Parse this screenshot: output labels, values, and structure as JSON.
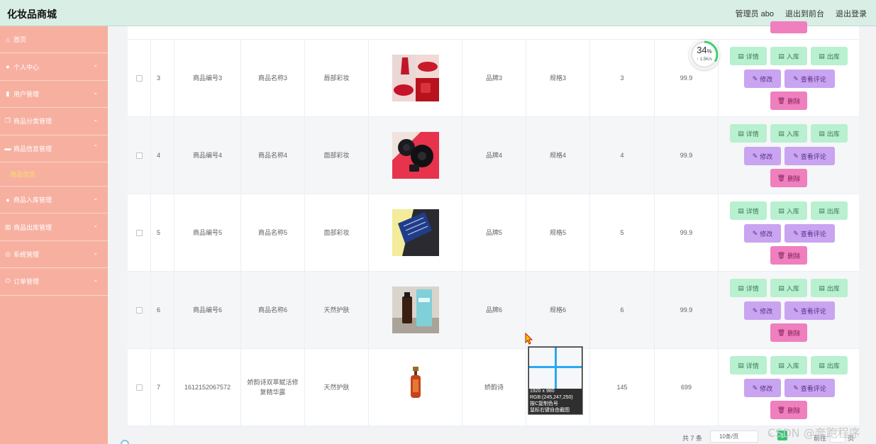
{
  "header": {
    "title": "化妆品商城",
    "admin": "管理员 abo",
    "to_front": "退出到前台",
    "logout": "退出登录"
  },
  "sidebar": {
    "items": [
      {
        "label": "首页",
        "icon": "home-icon",
        "glyph": "⌂",
        "chevron": false
      },
      {
        "label": "个人中心",
        "icon": "user-icon",
        "glyph": "●",
        "chevron": true
      },
      {
        "label": "用户管理",
        "icon": "users-icon",
        "glyph": "▮",
        "chevron": true
      },
      {
        "label": "商品分类管理",
        "icon": "copy-icon",
        "glyph": "❐",
        "chevron": true
      },
      {
        "label": "商品信息管理",
        "icon": "box-icon",
        "glyph": "▬",
        "chevron": true,
        "expanded": true
      },
      {
        "label": "商品入库管理",
        "icon": "user-icon",
        "glyph": "●",
        "chevron": true
      },
      {
        "label": "商品出库管理",
        "icon": "chart-icon",
        "glyph": "▥",
        "chevron": true
      },
      {
        "label": "系统管理",
        "icon": "settings-icon",
        "glyph": "◎",
        "chevron": true
      },
      {
        "label": "订单管理",
        "icon": "power-icon",
        "glyph": "⏻",
        "chevron": true
      }
    ],
    "submenu_active": "商品信息"
  },
  "table": {
    "rows": [
      {
        "id": "3",
        "code": "商品编号3",
        "name": "商品名称3",
        "category": "唇部彩妆",
        "brand": "品牌3",
        "spec": "规格3",
        "stock": "3",
        "price": "99.9"
      },
      {
        "id": "4",
        "code": "商品编号4",
        "name": "商品名称4",
        "category": "面部彩妆",
        "brand": "品牌4",
        "spec": "规格4",
        "stock": "4",
        "price": "99.9"
      },
      {
        "id": "5",
        "code": "商品编号5",
        "name": "商品名称5",
        "category": "面部彩妆",
        "brand": "品牌5",
        "spec": "规格5",
        "stock": "5",
        "price": "99.9"
      },
      {
        "id": "6",
        "code": "商品编号6",
        "name": "商品名称6",
        "category": "天然护肤",
        "brand": "品牌6",
        "spec": "规格6",
        "stock": "6",
        "price": "99.9"
      },
      {
        "id": "7",
        "code": "1612152067572",
        "name": "娇韵诗双萃赋活修复精华露",
        "category": "天然护肤",
        "brand": "娇韵诗",
        "spec": "",
        "stock": "145",
        "price": "699"
      }
    ],
    "actions": {
      "detail": "详情",
      "stock_in": "入库",
      "stock_out": "出库",
      "edit": "修改",
      "view_comments": "查看评论",
      "delete": "删除"
    }
  },
  "pagination": {
    "total": "共 7 条",
    "page_size": "10条/页",
    "current": "1",
    "goto": "前往",
    "page_unit": "页"
  },
  "overlay": {
    "speed_percent": "34",
    "speed_unit": "%",
    "speed_rate": "↑ 1.5K/s",
    "mag_line1": "1920 x 980",
    "mag_line2": "RGB:(245,247,250)",
    "mag_line3": "按C复制色号",
    "mag_line4": "鼠标右键自由截图",
    "watermark": "CSDN @奔跑程序"
  }
}
